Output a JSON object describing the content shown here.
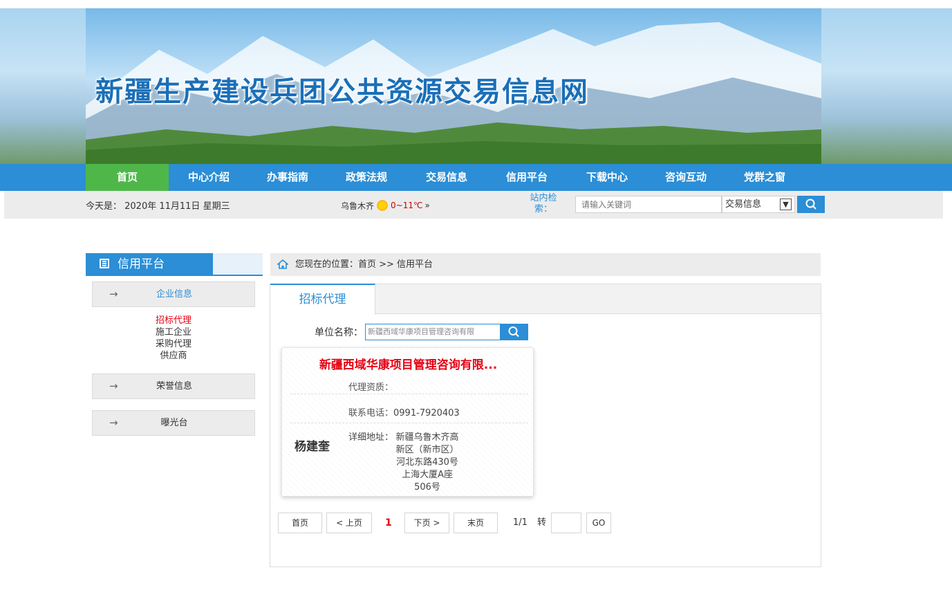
{
  "site": {
    "title": "新疆生产建设兵团公共资源交易信息网"
  },
  "nav": [
    {
      "label": "首页",
      "active": true
    },
    {
      "label": "中心介绍"
    },
    {
      "label": "办事指南"
    },
    {
      "label": "政策法规"
    },
    {
      "label": "交易信息"
    },
    {
      "label": "信用平台"
    },
    {
      "label": "下载中心"
    },
    {
      "label": "咨询互动"
    },
    {
      "label": "党群之窗"
    }
  ],
  "infobar": {
    "date": "今天是： 2020年 11月11日 星期三",
    "city": "乌鲁木齐",
    "temperature": "0~11℃",
    "more": "»",
    "search_label": "站内检索：",
    "search_placeholder": "请输入关键词",
    "search_scope": "交易信息"
  },
  "sidebar": {
    "title": "信用平台",
    "categories": [
      {
        "label": "企业信息",
        "subitems": [
          {
            "label": "招标代理",
            "active": true
          },
          {
            "label": "施工企业"
          },
          {
            "label": "采购代理"
          },
          {
            "label": "供应商"
          }
        ]
      },
      {
        "label": "荣誉信息"
      },
      {
        "label": "曝光台"
      }
    ]
  },
  "breadcrumb": "您现在的位置：首页 >> 信用平台",
  "tab": {
    "label": "招标代理"
  },
  "filter": {
    "label": "单位名称：",
    "value": "新疆西域华康项目管理咨询有限"
  },
  "card": {
    "title": "新疆西域华康项目管理咨询有限...",
    "person": "杨建奎",
    "qualification_label": "代理资质：",
    "qualification_value": "",
    "phone_label": "联系电话：",
    "phone_value": "0991-7920403",
    "address_label": "详细地址：",
    "address_value": "新疆乌鲁木齐高新区（新市区）河北东路430号上海大厦A座506号"
  },
  "pagination": {
    "first": "首页",
    "prev": "< 上页",
    "current": "1",
    "next": "下页 >",
    "last": "末页",
    "info": "1/1",
    "goto_label": "转",
    "go": "GO"
  },
  "colors": {
    "primary": "#2b8ed6",
    "active_nav": "#4fb74a",
    "highlight": "#e60012"
  }
}
